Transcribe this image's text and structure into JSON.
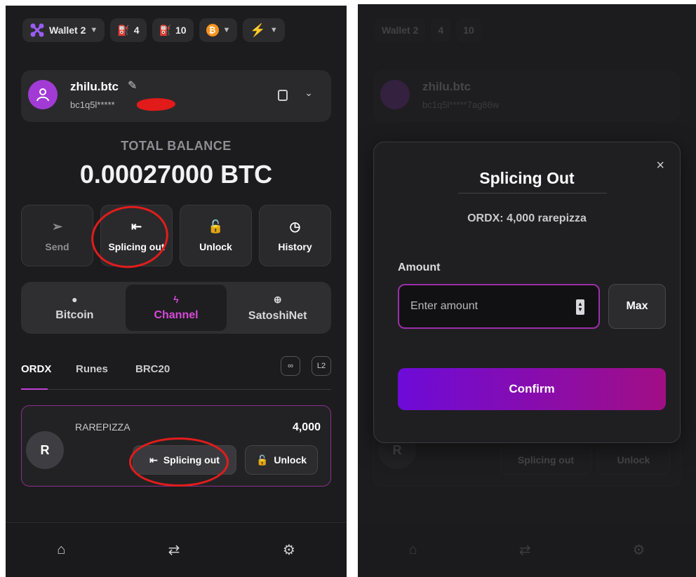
{
  "topbar": {
    "wallet_label": "Wallet 2",
    "count_a": "4",
    "count_b": "10",
    "btc_symbol": "₿"
  },
  "account": {
    "name": "zhilu.btc",
    "address_left": "bc1q5l*****",
    "address_right": "bc1q5l*****7ag86w"
  },
  "balance": {
    "label": "TOTAL BALANCE",
    "value": "0.00027000 BTC"
  },
  "actions": [
    {
      "label": "Send",
      "icon": "send-icon"
    },
    {
      "label": "Splicing out",
      "icon": "splice-icon"
    },
    {
      "label": "Unlock",
      "icon": "unlock-icon"
    },
    {
      "label": "History",
      "icon": "history-icon"
    }
  ],
  "networks": [
    {
      "label": "Bitcoin",
      "icon": "bitcoin-icon"
    },
    {
      "label": "Channel",
      "icon": "bolt-icon"
    },
    {
      "label": "SatoshiNet",
      "icon": "globe-icon"
    }
  ],
  "tabs": [
    "ORDX",
    "Runes",
    "BRC20"
  ],
  "tab_buttons": [
    "L2"
  ],
  "asset": {
    "avatar_letter": "R",
    "name": "RAREPIZZA",
    "amount": "4,000",
    "splice_label": "Splicing out",
    "unlock_label": "Unlock"
  },
  "modal": {
    "title": "Splicing Out",
    "token": "ORDX: 4,000 rarepizza",
    "amount_label": "Amount",
    "amount_placeholder": "Enter amount",
    "max_label": "Max",
    "confirm_label": "Confirm",
    "close": "×"
  },
  "colors": {
    "accent": "#c23fd1",
    "annotation": "#e21c1c",
    "confirm_start": "#6d0bd8",
    "confirm_end": "#a10e85"
  }
}
